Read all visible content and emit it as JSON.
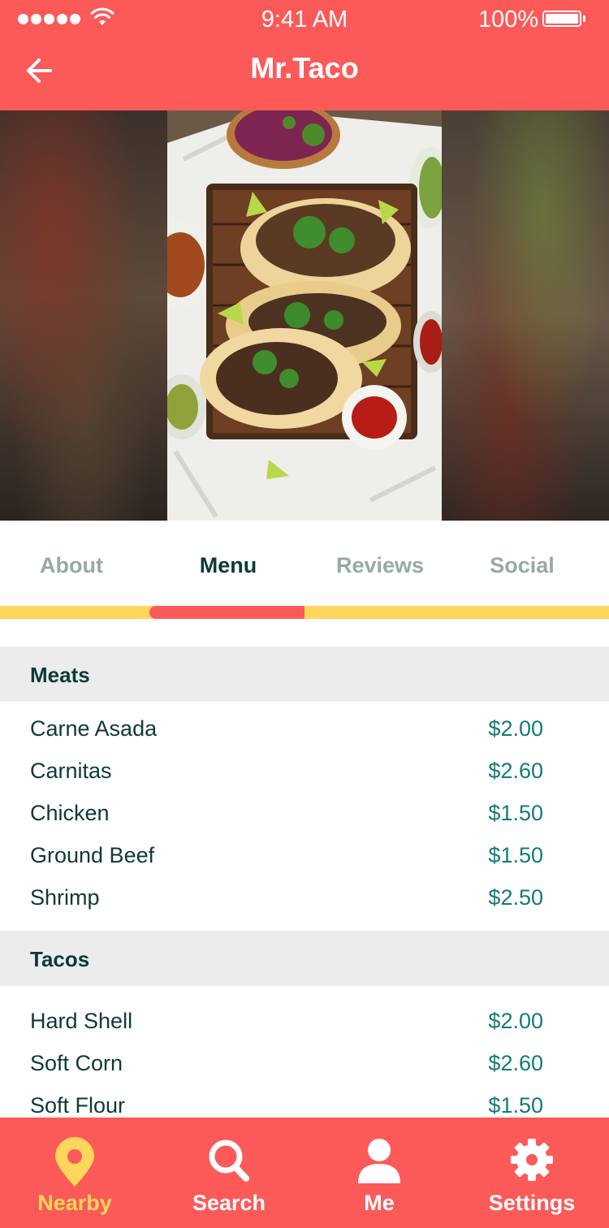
{
  "status_bar": {
    "time": "9:41 AM",
    "battery": "100%"
  },
  "header": {
    "title": "Mr.Taco",
    "back_icon": "arrow-left-icon"
  },
  "hero": {
    "image": "tacos-photo"
  },
  "tabs": [
    {
      "label": "About",
      "active": false
    },
    {
      "label": "Menu",
      "active": true
    },
    {
      "label": "Reviews",
      "active": false
    },
    {
      "label": "Social",
      "active": false
    }
  ],
  "menu": {
    "sections": [
      {
        "title": "Meats",
        "items": [
          {
            "name": "Carne Asada",
            "price": "$2.00"
          },
          {
            "name": "Carnitas",
            "price": "$2.60"
          },
          {
            "name": "Chicken",
            "price": "$1.50"
          },
          {
            "name": "Ground Beef",
            "price": "$1.50"
          },
          {
            "name": "Shrimp",
            "price": "$2.50"
          }
        ]
      },
      {
        "title": "Tacos",
        "items": [
          {
            "name": "Hard Shell",
            "price": "$2.00"
          },
          {
            "name": "Soft Corn",
            "price": "$2.60"
          },
          {
            "name": "Soft Flour",
            "price": "$1.50"
          }
        ]
      }
    ]
  },
  "bottom_nav": [
    {
      "label": "Nearby",
      "icon": "map-pin-icon",
      "active": true
    },
    {
      "label": "Search",
      "icon": "search-icon",
      "active": false
    },
    {
      "label": "Me",
      "icon": "user-icon",
      "active": false
    },
    {
      "label": "Settings",
      "icon": "gear-icon",
      "active": false
    }
  ],
  "colors": {
    "primary": "#fb5a59",
    "accent": "#fed65b",
    "text_dark": "#0d3a38",
    "price": "#137b77",
    "tab_inactive": "#97a9a7"
  }
}
